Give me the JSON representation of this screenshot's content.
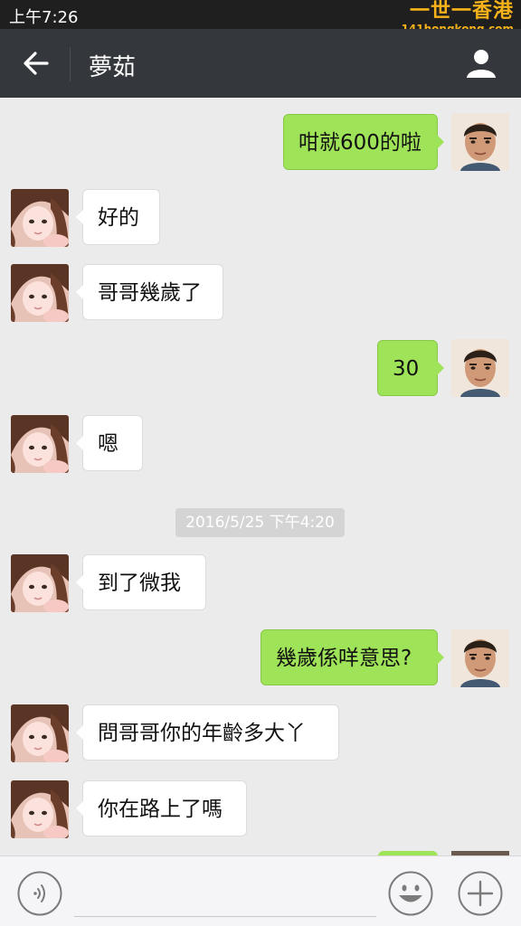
{
  "status_bar": {
    "time": "上午7:26"
  },
  "watermark": {
    "title": "一世一香港",
    "subtitle": "141hongkong.com"
  },
  "header": {
    "title": "夢茹"
  },
  "messages": [
    {
      "side": "out",
      "text": "咁就600的啦"
    },
    {
      "side": "in",
      "text": "好的"
    },
    {
      "side": "in",
      "text": "哥哥幾歲了"
    },
    {
      "side": "out",
      "text": "30"
    },
    {
      "side": "in",
      "text": "嗯"
    },
    {
      "side": "in",
      "text": "到了微我"
    },
    {
      "side": "out",
      "text": "幾歲係咩意思?"
    },
    {
      "side": "in",
      "text": "問哥哥你的年齡多大丫"
    },
    {
      "side": "in",
      "text": "你在路上了嗎"
    }
  ],
  "timestamp": "2016/5/25 下午4:20",
  "colors": {
    "nav_bg": "#34373c",
    "chat_bg": "#ebebeb",
    "outgoing_bubble": "#9fe358",
    "incoming_bubble": "#ffffff"
  },
  "icons": {
    "back": "back-arrow-icon",
    "profile": "person-icon",
    "voice": "voice-icon",
    "emoji": "smiley-icon",
    "more": "plus-icon"
  }
}
